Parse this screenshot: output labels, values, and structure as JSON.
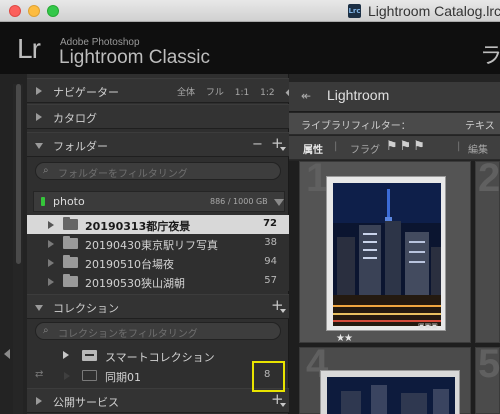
{
  "window": {
    "title": "Lightroom Catalog.lrca",
    "doc_icon": "Lrc"
  },
  "app": {
    "logo": "Lr",
    "brand_small": "Adobe Photoshop",
    "brand_big": "Lightroom Classic",
    "edge_char": "ラ"
  },
  "left_panel": {
    "navigator": {
      "label": "ナビゲーター",
      "modes": [
        "全体",
        "フル",
        "1:1",
        "1:2"
      ],
      "more": "◆"
    },
    "catalog": {
      "label": "カタログ"
    },
    "folders": {
      "label": "フォルダー",
      "remove": "−",
      "add": "+",
      "filter_placeholder": "フォルダーをフィルタリング",
      "volume": {
        "name": "photo",
        "size": "886 / 1000 GB"
      },
      "items": [
        {
          "name": "20190313都庁夜景",
          "count": "72",
          "selected": true
        },
        {
          "name": "20190430東京駅リフ写真",
          "count": "38",
          "selected": false
        },
        {
          "name": "20190510台場夜",
          "count": "94",
          "selected": false
        },
        {
          "name": "20190530狭山湖朝",
          "count": "57",
          "selected": false
        }
      ]
    },
    "collections": {
      "label": "コレクション",
      "add": "+",
      "filter_placeholder": "コレクションをフィルタリング",
      "smart": {
        "name": "スマートコレクション"
      },
      "synced": {
        "name": "同期01",
        "count": "8",
        "sync_symbol": "⇄"
      }
    },
    "publish": {
      "label": "公開サービス",
      "add": "+"
    },
    "search_symbol": "⌕"
  },
  "right": {
    "back_arrow": "↞",
    "module_title": "Lightroom",
    "filter_label": "ライブラリフィルター：",
    "filter_text_tab": "テキス",
    "attr_label": "属性",
    "flag_label": "フラグ",
    "flag_icons": "⚑⚑⚑",
    "edit_label": "編集",
    "separator": "|",
    "grid_numbers": [
      "1",
      "2",
      "4",
      "5"
    ],
    "rating": "★★",
    "badges": "▣▣▣"
  },
  "colors": {
    "accent_highlight": "#e9e400",
    "volume_led": "#35c63a",
    "panel_bg": "#2f2f2f"
  }
}
